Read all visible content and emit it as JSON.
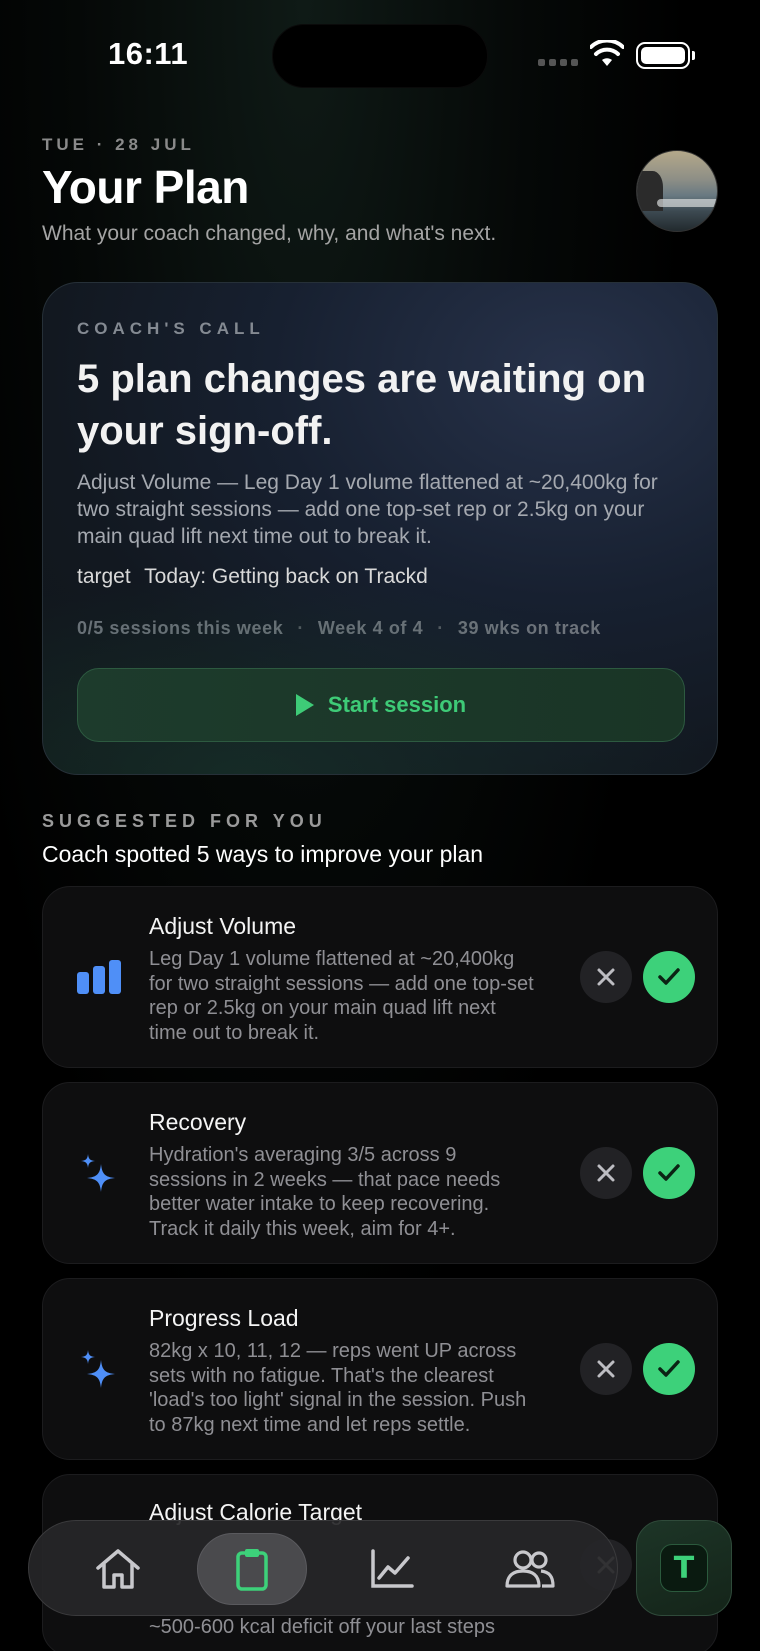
{
  "status_bar": {
    "time": "16:11"
  },
  "header": {
    "date": "TUE · 28 JUL",
    "title": "Your Plan",
    "subtitle": "What your coach changed, why, and what's next."
  },
  "coach_card": {
    "eyebrow": "COACH'S CALL",
    "headline": "5 plan changes are waiting on your sign-off.",
    "body": "Adjust Volume — Leg Day 1 volume flattened at ~20,400kg for two straight sessions — add one top-set rep or 2.5kg on your main quad lift next time out to break it.",
    "target_icon_text": "target",
    "target_text": "Today: Getting back on Trackd",
    "meta": [
      "0/5 sessions this week",
      "Week 4 of 4",
      "39 wks on track"
    ],
    "meta_separator": "·",
    "start_label": "Start session"
  },
  "suggested": {
    "eyebrow": "SUGGESTED FOR YOU",
    "title": "Coach spotted 5 ways to improve your plan",
    "items": [
      {
        "icon": "bar-chart-icon",
        "title": "Adjust Volume",
        "body": "Leg Day 1 volume flattened at ~20,400kg for two straight sessions — add one top-set rep or 2.5kg on your main quad lift next time out to break it."
      },
      {
        "icon": "sparkles-icon",
        "title": "Recovery",
        "body": "Hydration's averaging 3/5 across 9 sessions in 2 weeks — that pace needs better water intake to keep recovering. Track it daily this week, aim for 4+."
      },
      {
        "icon": "sparkles-icon",
        "title": "Progress Load",
        "body": "82kg x 10, 11, 12 — reps went UP across sets with no fatigue. That's the clearest 'load's too light' signal in the session. Push to 87kg next time and let reps settle."
      },
      {
        "icon": "sparkles-icon",
        "title": "Adjust Calorie Target",
        "body": "~500-600 kcal deficit off your last steps"
      }
    ]
  },
  "tab_bar": {
    "tabs": [
      {
        "name": "home-icon",
        "active": false
      },
      {
        "name": "clipboard-icon",
        "active": true
      },
      {
        "name": "chart-line-icon",
        "active": false
      },
      {
        "name": "people-icon",
        "active": false
      }
    ],
    "fab_letter": "T"
  },
  "colors": {
    "accent_green": "#3dd17a",
    "accent_blue": "#4f8ff7",
    "background": "#000000"
  }
}
